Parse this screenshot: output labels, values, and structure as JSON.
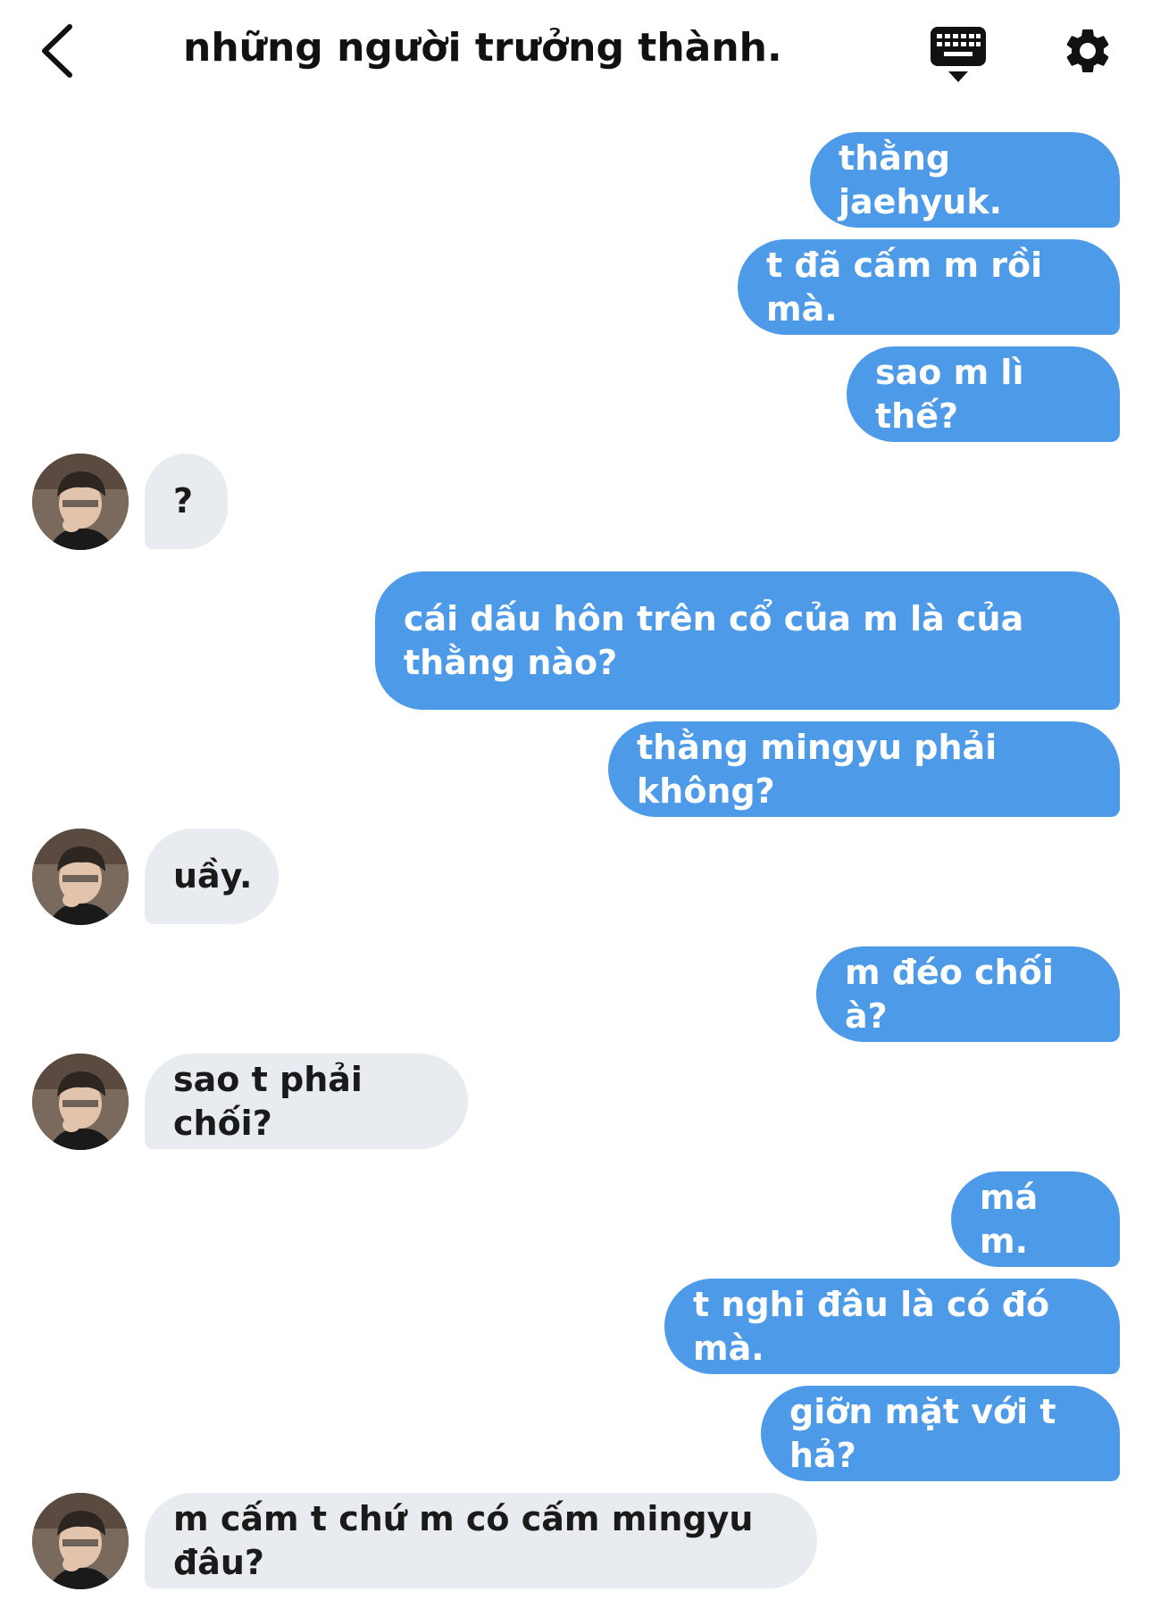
{
  "header": {
    "title": "những người trưởng thành.",
    "back_icon": "chevron-left-icon",
    "keyboard_icon": "keyboard-icon",
    "settings_icon": "gear-icon"
  },
  "colors": {
    "outgoing_bubble": "#4d9be8",
    "incoming_bubble": "#e8ebef"
  },
  "messages": [
    {
      "sender": "me",
      "text": "thằng jaehyuk."
    },
    {
      "sender": "me",
      "text": "t đã cấm m rồi mà."
    },
    {
      "sender": "me",
      "text": "sao m lì thế?"
    },
    {
      "sender": "them",
      "text": "?"
    },
    {
      "sender": "me",
      "text": "cái dấu hôn trên cổ của m là của thằng nào?"
    },
    {
      "sender": "me",
      "text": "thằng mingyu phải không?"
    },
    {
      "sender": "them",
      "text": "uầy."
    },
    {
      "sender": "me",
      "text": "m đéo chối à?"
    },
    {
      "sender": "them",
      "text": "sao t phải chối?"
    },
    {
      "sender": "me",
      "text": "má m."
    },
    {
      "sender": "me",
      "text": "t nghi đâu là có đó mà."
    },
    {
      "sender": "me",
      "text": "giỡn mặt với t hả?"
    },
    {
      "sender": "them",
      "text": "m cấm t chứ m có cấm mingyu đâu?"
    }
  ]
}
